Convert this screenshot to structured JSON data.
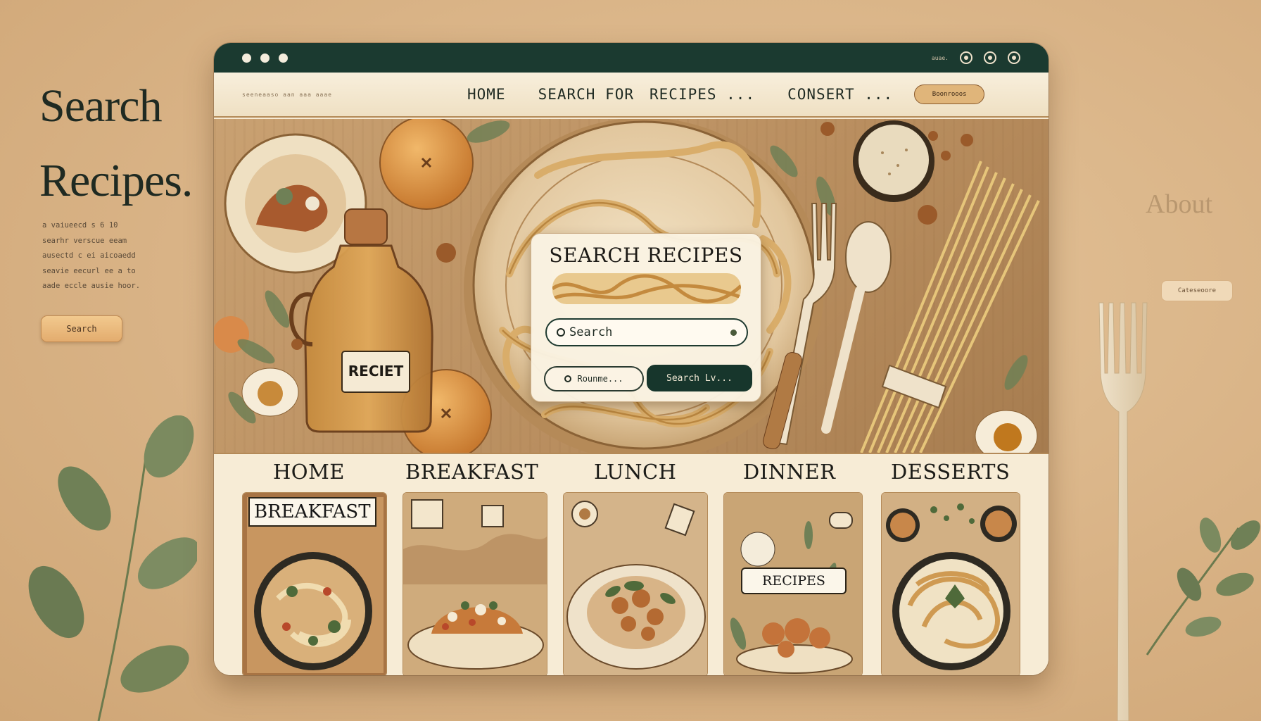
{
  "promo": {
    "title_line1": "Search",
    "title_line2": "Recipes.",
    "body_lines": [
      "a vaiueecd s 6 10",
      "searhr verscue eeam",
      "ausectd c ei aicoaedd",
      "seavie eecurl ee a to",
      "aade eccle ausie hoor."
    ],
    "button_label": "Search"
  },
  "right": {
    "about_label": "About",
    "pill_label": "Cateseoore"
  },
  "window": {
    "titlebar": {
      "small_text": "auae.",
      "icons": [
        "settings-icon",
        "location-icon",
        "profile-icon"
      ]
    },
    "nav": {
      "brand": "seeneaaso aan aaa aaae",
      "links": [
        "HOME",
        "SEARCH  FOR",
        "RECIPES ...",
        "CONSERT ..."
      ],
      "cta_label": "Boonrooos"
    },
    "hero": {
      "bottle_label": "RECIET",
      "search_card": {
        "title": "SEARCH RECIPES",
        "input_placeholder": "Search",
        "reset_label": "Rounme...",
        "go_label": "Search Lv..."
      }
    },
    "categories": {
      "tabs": [
        "HOME",
        "BREAKFAST",
        "LUNCH",
        "DINNER",
        "DESSERTS"
      ],
      "cards": [
        {
          "label": "BREAKFAST"
        },
        {
          "label": ""
        },
        {
          "label": ""
        },
        {
          "label": "RECIPES"
        },
        {
          "label": ""
        }
      ]
    }
  },
  "colors": {
    "page_bg": "#d9b386",
    "titlebar": "#1b3a30",
    "accent_dark": "#17362c",
    "accent_warm": "#e0b57a",
    "cream": "#f6ead3"
  }
}
